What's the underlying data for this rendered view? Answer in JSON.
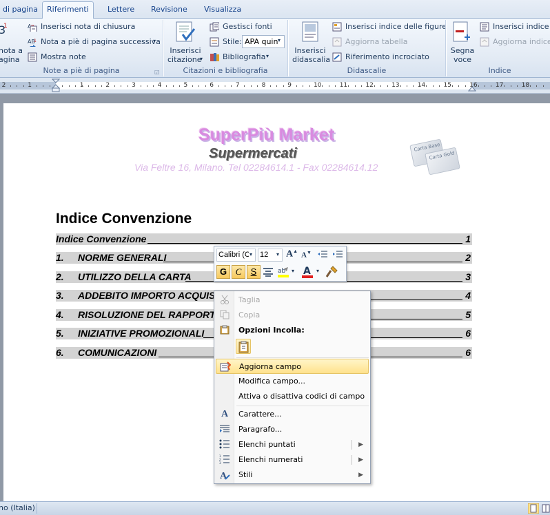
{
  "tabs": [
    {
      "label": "di pagina",
      "active": false
    },
    {
      "label": "Riferimenti",
      "active": true
    },
    {
      "label": "Lettere",
      "active": false
    },
    {
      "label": "Revisione",
      "active": false
    },
    {
      "label": "Visualizza",
      "active": false
    }
  ],
  "ribbon": {
    "footnotes": {
      "big_label_line1": "nota a",
      "big_label_line2": "agina",
      "insert_endnote": "Inserisci nota di chiusura",
      "next_footnote": "Nota a piè di pagina successiva",
      "show_notes": "Mostra note",
      "group_label": "Note a piè di pagina"
    },
    "citations": {
      "insert_citation_line1": "Inserisci",
      "insert_citation_line2": "citazione",
      "manage_sources": "Gestisci fonti",
      "style_label": "Stile:",
      "style_value": "APA quin",
      "bibliography": "Bibliografia",
      "group_label": "Citazioni e bibliografia"
    },
    "captions": {
      "insert_caption_line1": "Inserisci",
      "insert_caption_line2": "didascalia",
      "insert_figure_index": "Inserisci indice delle figure",
      "update_table": "Aggiorna tabella",
      "cross_reference": "Riferimento incrociato",
      "group_label": "Didascalie"
    },
    "index": {
      "mark_entry_line1": "Segna",
      "mark_entry_line2": "voce",
      "insert_index": "Inserisci indice",
      "update_index": "Aggiorna indice",
      "group_label": "Indice"
    }
  },
  "ruler": {
    "ticks": [
      "2",
      "1",
      "1",
      "2",
      "3",
      "4",
      "5",
      "6",
      "7",
      "8",
      "9",
      "10",
      "11",
      "12",
      "13",
      "14",
      "15",
      "16",
      "17",
      "18"
    ]
  },
  "letterhead": {
    "brand": "SuperPiù Market",
    "subtitle": "Supermercati",
    "address": "Via Feltre 16, Milano. Tel 02284614.1 - Fax 02284614.12",
    "card_text_1": "Carta Base",
    "card_text_2": "Carta Gold"
  },
  "document": {
    "heading": "Indice Convenzione",
    "toc": [
      {
        "num": "",
        "title": "Indice Convenzione",
        "page": "1"
      },
      {
        "num": "1.",
        "title": "NORME GENERALI",
        "page": "2"
      },
      {
        "num": "2.",
        "title": "UTILIZZO DELLA CARTA",
        "page": "3"
      },
      {
        "num": "3.",
        "title": "ADDEBITO IMPORTO ACQUIS",
        "page": "4"
      },
      {
        "num": "4.",
        "title": "RISOLUZIONE DEL RAPPORTO",
        "page": "5"
      },
      {
        "num": "5.",
        "title": "INIZIATIVE PROMOZIONALI",
        "page": "6"
      },
      {
        "num": "6.",
        "title": "COMUNICAZIONI",
        "page": "6"
      }
    ]
  },
  "minitoolbar": {
    "font": "Calibri (C",
    "size": "12",
    "bold": "G",
    "italic": "C",
    "underline": "S"
  },
  "context_menu": {
    "cut": "Taglia",
    "copy": "Copia",
    "paste_options": "Opzioni Incolla:",
    "update_field": "Aggiorna campo",
    "edit_field": "Modifica campo...",
    "toggle_codes": "Attiva o disattiva codici di campo",
    "font": "Carattere...",
    "paragraph": "Paragrafo...",
    "bullets": "Elenchi puntati",
    "numbering": "Elenchi numerati",
    "styles": "Stili"
  },
  "status": {
    "language": "no (Italia)"
  },
  "colors": {
    "highlight": "#ffe28c",
    "brand_pink": "#d98be0",
    "toc_shading": "#d3d3d3"
  }
}
